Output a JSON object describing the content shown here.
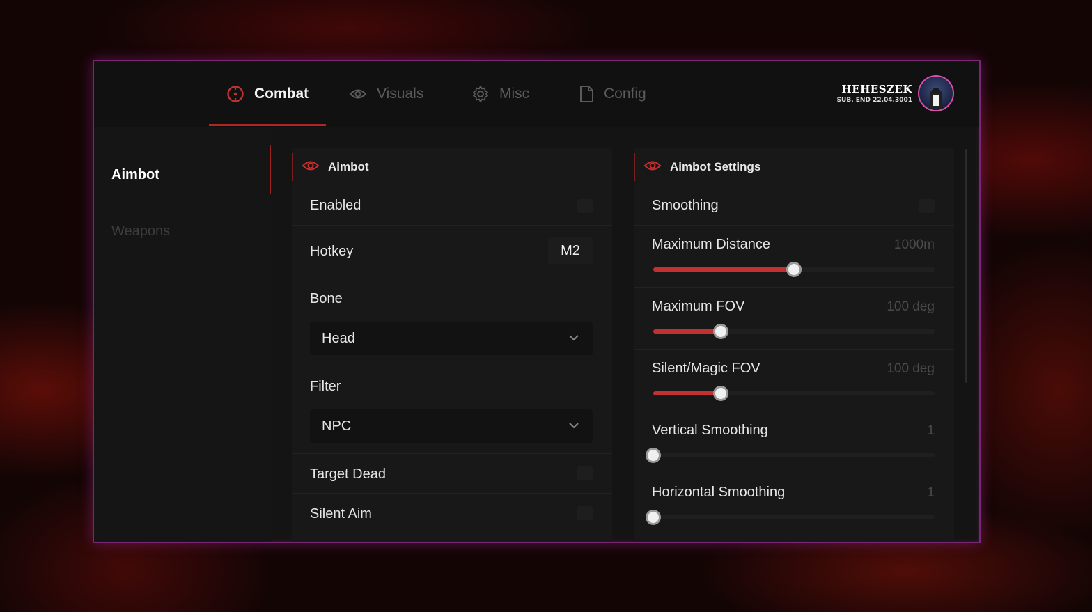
{
  "tabs": [
    {
      "label": "Combat",
      "icon": "crosshair-icon",
      "active": true
    },
    {
      "label": "Visuals",
      "icon": "eye-icon",
      "active": false
    },
    {
      "label": "Misc",
      "icon": "gear-icon",
      "active": false
    },
    {
      "label": "Config",
      "icon": "file-icon",
      "active": false
    }
  ],
  "user": {
    "name": "HEHESZEK",
    "subscription": "SUB. END 22.04.3001"
  },
  "sidebar": {
    "items": [
      {
        "label": "Aimbot",
        "active": true
      },
      {
        "label": "Weapons",
        "active": false
      }
    ]
  },
  "aimbot_panel": {
    "title": "Aimbot",
    "enabled_label": "Enabled",
    "hotkey_label": "Hotkey",
    "hotkey_value": "M2",
    "bone_label": "Bone",
    "bone_value": "Head",
    "filter_label": "Filter",
    "filter_value": "NPC",
    "target_dead_label": "Target Dead",
    "silent_aim_label": "Silent Aim"
  },
  "settings_panel": {
    "title": "Aimbot Settings",
    "smoothing_label": "Smoothing",
    "sliders": [
      {
        "label": "Maximum Distance",
        "value_text": "1000m",
        "fraction": 0.5
      },
      {
        "label": "Maximum FOV",
        "value_text": "100 deg",
        "fraction": 0.24
      },
      {
        "label": "Silent/Magic FOV",
        "value_text": "100 deg",
        "fraction": 0.24
      },
      {
        "label": "Vertical Smoothing",
        "value_text": "1",
        "fraction": 0.0
      },
      {
        "label": "Horizontal Smoothing",
        "value_text": "1",
        "fraction": 0.0
      }
    ]
  },
  "colors": {
    "accent": "#c23030",
    "border": "#7a2670",
    "background": "#141414"
  }
}
